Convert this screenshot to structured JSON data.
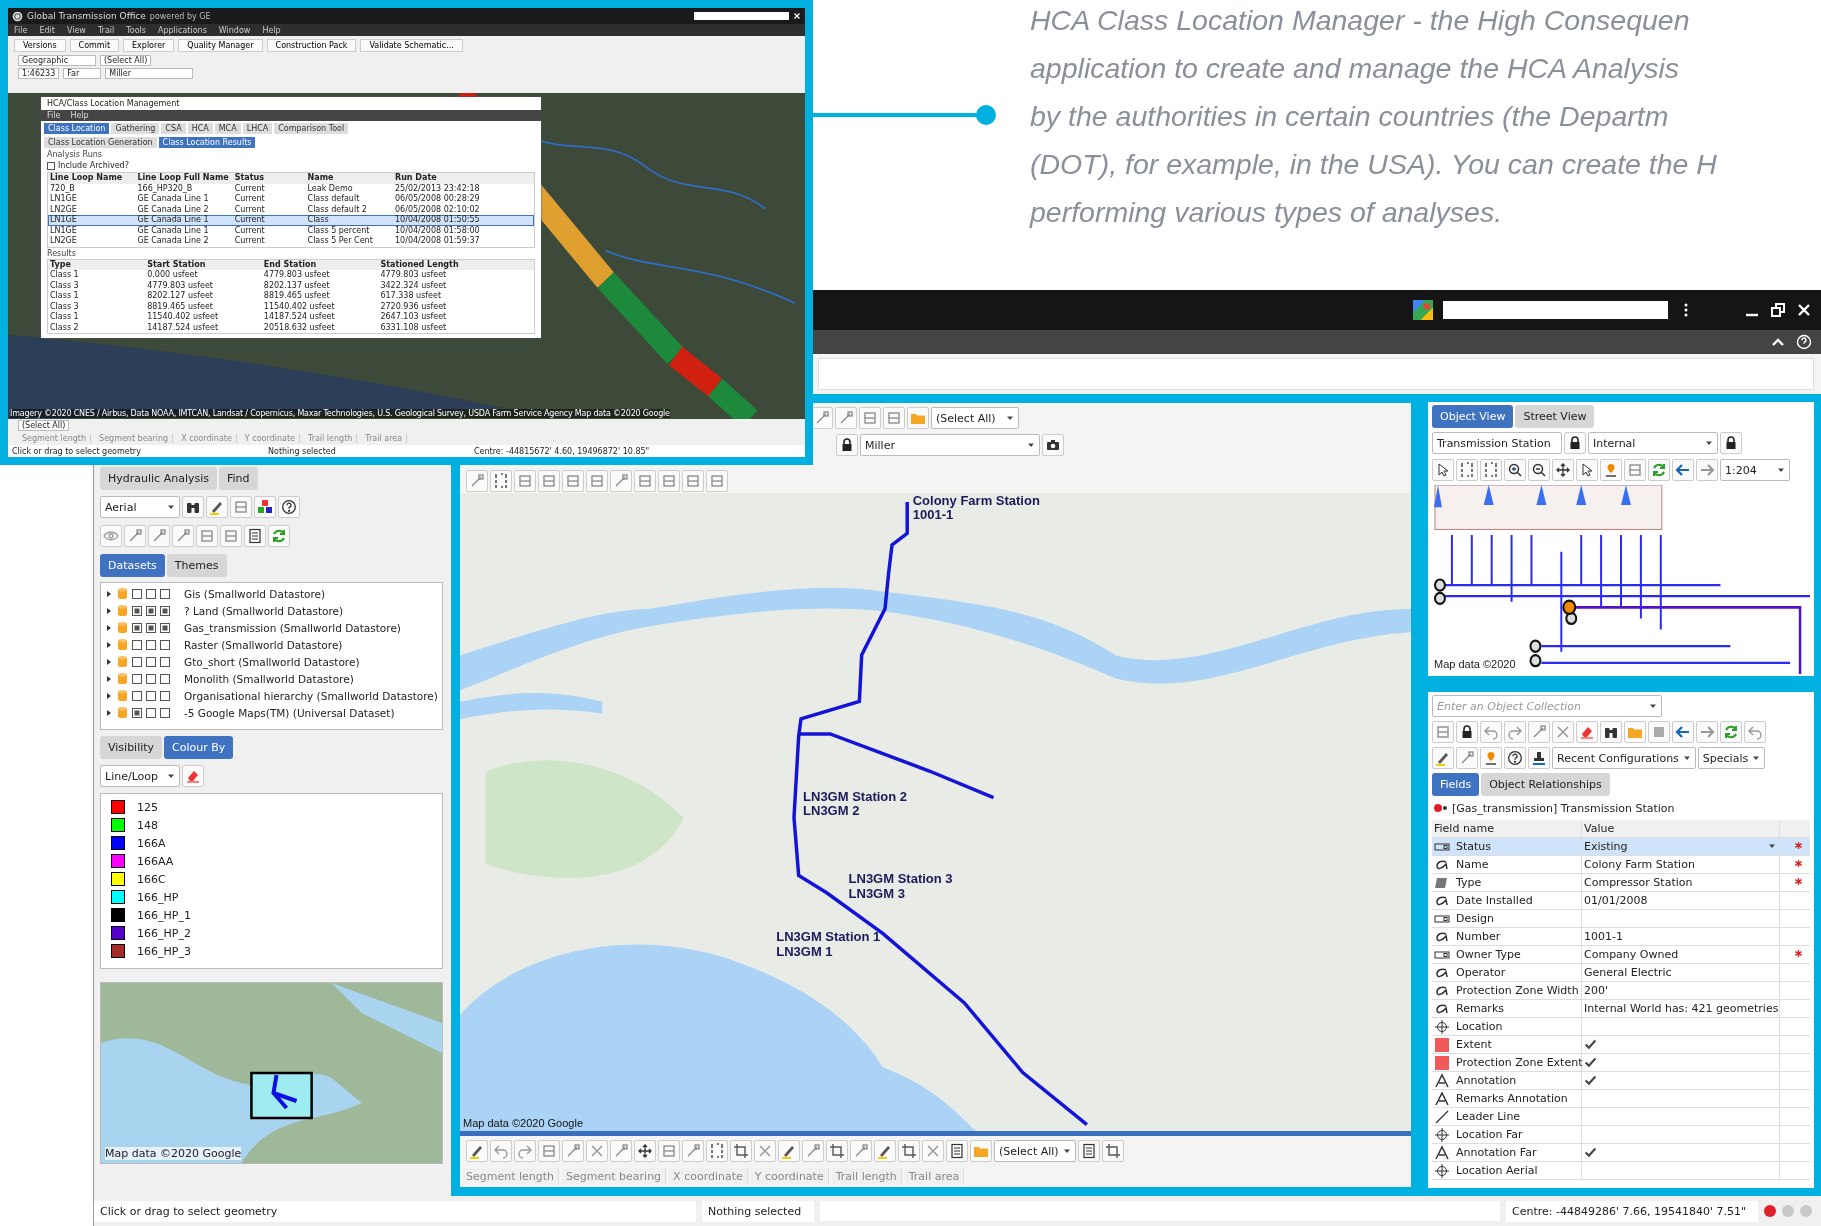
{
  "description": {
    "lines": [
      "HCA Class Location Manager - the High Consequen",
      "application to create and manage the HCA Analysis",
      "by the authorities in certain countries (the Departm",
      "(DOT), for example, in the USA). You can create the H",
      "performing various types of analyses."
    ]
  },
  "inset": {
    "title": "Global Transmission Office",
    "brand": "powered by GE",
    "menu": [
      "File",
      "Edit",
      "View",
      "Trail",
      "Tools",
      "Applications",
      "Window",
      "Help"
    ],
    "toolbar": [
      "Versions",
      "Commit",
      "Explorer",
      "Quality Manager",
      "Construction Pack",
      "Validate Schematic..."
    ],
    "view": "Geographic",
    "scale": "1:46233",
    "unit": "Far",
    "world": "Miller",
    "select_all": "(Select All)",
    "dialog": {
      "title": "HCA/Class Location Management",
      "menu": [
        "File",
        "Help"
      ],
      "tabs": [
        {
          "label": "Class Location",
          "selected": true
        },
        {
          "label": "Gathering",
          "selected": false
        },
        {
          "label": "CSA",
          "selected": false
        },
        {
          "label": "HCA",
          "selected": false
        },
        {
          "label": "MCA",
          "selected": false
        },
        {
          "label": "LHCA",
          "selected": false
        },
        {
          "label": "Comparison Tool",
          "selected": false
        }
      ],
      "subtabs": [
        {
          "label": "Class Location Generation",
          "selected": false
        },
        {
          "label": "Class Location Results",
          "selected": true
        }
      ],
      "runs_label": "Analysis Runs",
      "include_archived": {
        "label": "Include Archived?",
        "checked": false
      },
      "runs": {
        "columns": [
          "Line Loop Name",
          "Line Loop Full Name",
          "Status",
          "Name",
          "Run Date"
        ],
        "rows": [
          {
            "cells": [
              "720_B",
              "166_HP320_B",
              "Current",
              "Leak Demo",
              "25/02/2013 23:42:18"
            ],
            "selected": false
          },
          {
            "cells": [
              "LN1GE",
              "GE Canada Line 1",
              "Current",
              "Class default",
              "06/05/2008 00:28:29"
            ],
            "selected": false
          },
          {
            "cells": [
              "LN2GE",
              "GE Canada Line 2",
              "Current",
              "Class default 2",
              "06/05/2008 02:10:02"
            ],
            "selected": false
          },
          {
            "cells": [
              "LN1GE",
              "GE Canada Line 1",
              "Current",
              "Class",
              "10/04/2008 01:50:55"
            ],
            "selected": true
          },
          {
            "cells": [
              "LN1GE",
              "GE Canada Line 1",
              "Current",
              "Class 5 percent",
              "10/04/2008 01:58:00"
            ],
            "selected": false
          },
          {
            "cells": [
              "LN2GE",
              "GE Canada Line 2",
              "Current",
              "Class 5 Per Cent",
              "10/04/2008 01:59:37"
            ],
            "selected": false
          }
        ]
      },
      "results_label": "Results",
      "results": {
        "columns": [
          "Type",
          "Start Station",
          "End Station",
          "Stationed Length"
        ],
        "rows": [
          [
            "Class 1",
            "0.000 usfeet",
            "4779.803 usfeet",
            "4779.803 usfeet"
          ],
          [
            "Class 3",
            "4779.803 usfeet",
            "8202.137 usfeet",
            "3422.324 usfeet"
          ],
          [
            "Class 1",
            "8202.127 usfeet",
            "8819.465 usfeet",
            "617.338 usfeet"
          ],
          [
            "Class 3",
            "8819.465 usfeet",
            "11540.402 usfeet",
            "2720.936 usfeet"
          ],
          [
            "Class 1",
            "11540.402 usfeet",
            "14187.524 usfeet",
            "2647.103 usfeet"
          ],
          [
            "Class 2",
            "14187.524 usfeet",
            "20518.632 usfeet",
            "6331.108 usfeet"
          ]
        ]
      }
    },
    "attribution": "Imagery ©2020 CNES / Airbus, Data NOAA, IMTCAN, Landsat / Copernicus, Maxar Technologies, U.S. Geological Survey, USDA Farm Service Agency Map data ©2020 Google",
    "select_all_bottom": "(Select All)",
    "fields": [
      "Segment length",
      "Segment bearing",
      "X coordinate",
      "Y coordinate",
      "Trail length",
      "Trail area"
    ],
    "status": {
      "message": "Click or drag to select geometry",
      "selection": "Nothing selected",
      "centre": "Centre: -44815672' 4.60, 19496872' 10.85\""
    }
  },
  "window": {
    "left": {
      "tabs": [
        "Hydraulic Analysis",
        "Find"
      ],
      "view": "Aerial",
      "dataset_tabs": [
        {
          "label": "Datasets",
          "selected": true
        },
        {
          "label": "Themes",
          "selected": false
        }
      ],
      "datasets": [
        {
          "label": "Gis (Smallworld Datastore)",
          "checks": [
            false,
            false,
            false
          ]
        },
        {
          "label": "? Land (Smallworld Datastore)",
          "checks": [
            true,
            true,
            true
          ]
        },
        {
          "label": "Gas_transmission (Smallworld Datastore)",
          "checks": [
            true,
            true,
            true
          ]
        },
        {
          "label": "Raster (Smallworld Datastore)",
          "checks": [
            false,
            false,
            false
          ]
        },
        {
          "label": "Gto_short (Smallworld Datastore)",
          "checks": [
            false,
            false,
            false
          ]
        },
        {
          "label": "Monolith (Smallworld Datastore)",
          "checks": [
            false,
            false,
            false
          ]
        },
        {
          "label": "Organisational hierarchy (Smallworld Datastore)",
          "checks": [
            false,
            false,
            false
          ]
        },
        {
          "label": "-5 Google Maps(TM) (Universal Dataset)",
          "checks": [
            true,
            false,
            false
          ]
        }
      ],
      "colour_tabs": [
        {
          "label": "Visibility",
          "selected": false
        },
        {
          "label": "Colour By",
          "selected": true
        }
      ],
      "colour_field": "Line/Loop",
      "legend": [
        {
          "label": "125",
          "color": "#ff0000"
        },
        {
          "label": "148",
          "color": "#00ff00"
        },
        {
          "label": "166A",
          "color": "#0000ff"
        },
        {
          "label": "166AA",
          "color": "#ff00ff"
        },
        {
          "label": "166C",
          "color": "#ffff00"
        },
        {
          "label": "166_HP",
          "color": "#00ffff"
        },
        {
          "label": "166_HP_1",
          "color": "#000000"
        },
        {
          "label": "166_HP_2",
          "color": "#5500cc"
        },
        {
          "label": "166_HP_3",
          "color": "#a52a2a"
        }
      ],
      "minimap_attribution": "Map data ©2020 Google"
    },
    "map": {
      "select_all": "(Select All)",
      "world": "Miller",
      "labels": [
        {
          "lines": [
            "Colony Farm Station",
            "1001-1"
          ]
        },
        {
          "lines": [
            "LN3GM Station 2",
            "LN3GM 2"
          ]
        },
        {
          "lines": [
            "LN3GM Station 3",
            "LN3GM 3"
          ]
        },
        {
          "lines": [
            "LN3GM Station 1",
            "LN3GM 1"
          ]
        }
      ],
      "attribution": "Map data ©2020 Google",
      "select_all_bottom": "(Select All)",
      "fields": [
        "Segment length",
        "Segment bearing",
        "X coordinate",
        "Y coordinate",
        "Trail length",
        "Trail area"
      ]
    },
    "object_view": {
      "tabs": [
        {
          "label": "Object View",
          "selected": true
        },
        {
          "label": "Street View",
          "selected": false
        }
      ],
      "collection": "Transmission Station",
      "world": "Internal",
      "scale": "1:204",
      "attribution": "Map data ©2020"
    },
    "editor": {
      "placeholder": "Enter an Object Collection",
      "recent": "Recent Configurations",
      "specials": "Specials",
      "tabs": [
        {
          "label": "Fields",
          "selected": true
        },
        {
          "label": "Object Relationships",
          "selected": false
        }
      ],
      "object_title": "[Gas_transmission] Transmission Station",
      "columns": [
        "Field name",
        "Value"
      ],
      "rows": [
        {
          "kind": "enum",
          "name": "Status",
          "value": "Existing",
          "mandatory": true,
          "selected": true
        },
        {
          "kind": "text",
          "name": "Name",
          "value": "Colony Farm Station",
          "mandatory": true,
          "selected": false
        },
        {
          "kind": "book",
          "name": "Type",
          "value": "Compressor Station",
          "mandatory": true,
          "selected": false
        },
        {
          "kind": "text",
          "name": "Date Installed",
          "value": "01/01/2008",
          "mandatory": false,
          "selected": false
        },
        {
          "kind": "enum",
          "name": "Design",
          "mandatory": false,
          "selected": false
        },
        {
          "kind": "text",
          "name": "Number",
          "value": "1001-1",
          "mandatory": false,
          "selected": false
        },
        {
          "kind": "enum",
          "name": "Owner Type",
          "value": "Company Owned",
          "mandatory": true,
          "selected": false
        },
        {
          "kind": "text",
          "name": "Operator",
          "value": "General Electric",
          "mandatory": false,
          "selected": false
        },
        {
          "kind": "text",
          "name": "Protection Zone Width",
          "value": "200'",
          "mandatory": false,
          "selected": false
        },
        {
          "kind": "text",
          "name": "Remarks",
          "value": "Internal World has: 421 geometries",
          "mandatory": false,
          "selected": false
        },
        {
          "kind": "point",
          "name": "Location",
          "mandatory": false,
          "selected": false,
          "check": false
        },
        {
          "kind": "area",
          "name": "Extent",
          "mandatory": false,
          "selected": false,
          "check": true
        },
        {
          "kind": "area",
          "name": "Protection Zone Extent",
          "mandatory": false,
          "selected": false,
          "check": true
        },
        {
          "kind": "annotation",
          "name": "Annotation",
          "mandatory": false,
          "selected": false,
          "check": true
        },
        {
          "kind": "annotation",
          "name": "Remarks Annotation",
          "mandatory": false,
          "selected": false,
          "check": false
        },
        {
          "kind": "line",
          "name": "Leader Line",
          "mandatory": false,
          "selected": false,
          "check": false
        },
        {
          "kind": "point",
          "name": "Location Far",
          "mandatory": false,
          "selected": false,
          "check": false
        },
        {
          "kind": "annotation",
          "name": "Annotation Far",
          "mandatory": false,
          "selected": false,
          "check": true
        },
        {
          "kind": "point",
          "name": "Location Aerial",
          "mandatory": false,
          "selected": false,
          "check": false
        }
      ]
    },
    "status": {
      "message": "Click or drag to select geometry",
      "selection": "Nothing selected",
      "centre": "Centre: -44849286' 7.66, 19541840' 7.51\"",
      "lights": [
        {
          "color": "#e0202a"
        },
        {
          "color": "#c8c8c8"
        },
        {
          "color": "#c8c8c8"
        }
      ]
    }
  }
}
